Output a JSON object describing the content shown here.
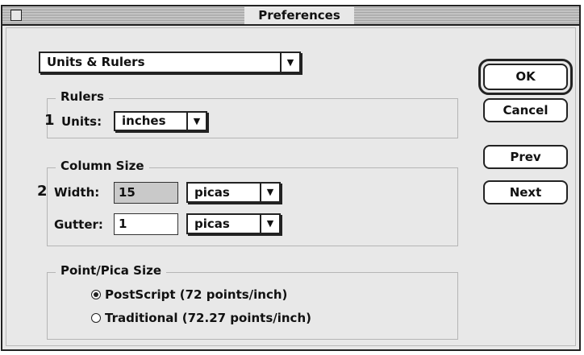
{
  "window": {
    "title": "Preferences"
  },
  "panel_select": {
    "value": "Units & Rulers"
  },
  "rulers": {
    "title": "Rulers",
    "step": "1",
    "units_label": "Units:",
    "units_value": "inches"
  },
  "column_size": {
    "title": "Column Size",
    "step": "2",
    "width_label": "Width:",
    "width_value": "15",
    "width_unit": "picas",
    "gutter_label": "Gutter:",
    "gutter_value": "1",
    "gutter_unit": "picas"
  },
  "point_pica": {
    "title": "Point/Pica Size",
    "options": [
      {
        "label": "PostScript (72 points/inch)",
        "selected": true
      },
      {
        "label": "Traditional (72.27 points/inch)",
        "selected": false
      }
    ]
  },
  "buttons": {
    "ok": "OK",
    "cancel": "Cancel",
    "prev": "Prev",
    "next": "Next"
  },
  "icons": {
    "popup_arrow": "chevron-down-icon",
    "close_box": "close-box-icon"
  }
}
